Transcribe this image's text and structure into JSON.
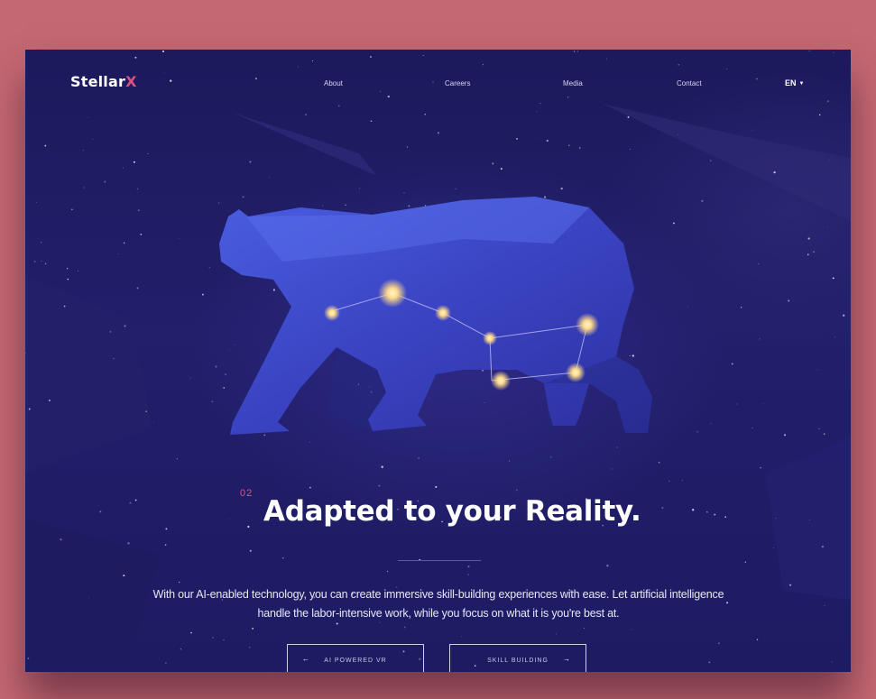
{
  "brand": {
    "name": "Stellar",
    "accent_letter": "X",
    "accent_color": "#e0507e"
  },
  "nav": {
    "items": [
      {
        "label": "About"
      },
      {
        "label": "Careers"
      },
      {
        "label": "Media"
      },
      {
        "label": "Contact"
      }
    ],
    "language": "EN",
    "language_icon": "caret-down-icon"
  },
  "hero": {
    "image": "polar-bear-constellation",
    "section_number": "02",
    "headline": "Adapted to your Reality.",
    "body": "With our AI-enabled technology, you can create immersive skill-building experiences with ease. Let artificial intelligence handle the labor-intensive work, while you focus on what it is you're best at."
  },
  "buttons": {
    "prev": {
      "label": "AI POWERED VR",
      "icon": "arrow-left-icon"
    },
    "next": {
      "label": "SKILL BUILDING",
      "icon": "arrow-right-icon"
    }
  },
  "colors": {
    "page_background": "#c46873",
    "site_background": "#1e1c63",
    "bear": "#3b46c8",
    "star_glow": "#ffe6a0"
  }
}
